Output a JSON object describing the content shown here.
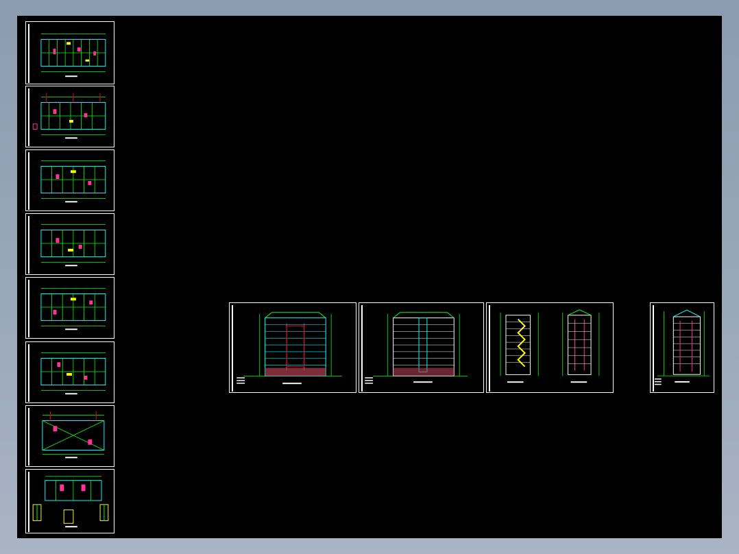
{
  "app": {
    "viewport_background": "#000000",
    "frame_color": "#ffffff",
    "line_colors": {
      "grid": "#00ff00",
      "walls": "#00ffff",
      "accent": "#ff3399",
      "highlight": "#ffff00",
      "dimension": "#ff0000",
      "base": "#b04050",
      "text": "#ffffff"
    }
  },
  "floor_plan_sheets": [
    {
      "id": "plan-1",
      "kind": "floor-plan"
    },
    {
      "id": "plan-2",
      "kind": "floor-plan"
    },
    {
      "id": "plan-3",
      "kind": "floor-plan"
    },
    {
      "id": "plan-4",
      "kind": "floor-plan"
    },
    {
      "id": "plan-5",
      "kind": "floor-plan"
    },
    {
      "id": "plan-6",
      "kind": "floor-plan"
    },
    {
      "id": "plan-7",
      "kind": "roof-plan"
    },
    {
      "id": "plan-8",
      "kind": "detail-plan"
    }
  ],
  "elevation_sheets": [
    {
      "id": "elev-1",
      "kind": "front-elevation"
    },
    {
      "id": "elev-2",
      "kind": "rear-elevation"
    },
    {
      "id": "elev-3",
      "kind": "side-elevations"
    },
    {
      "id": "elev-4",
      "kind": "section"
    }
  ]
}
